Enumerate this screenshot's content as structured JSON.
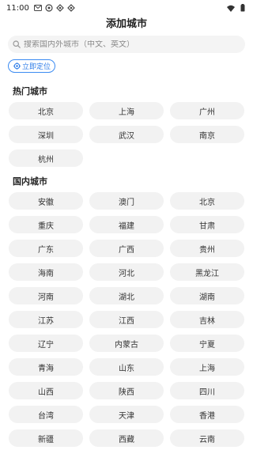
{
  "status_bar": {
    "time": "11:00",
    "left_icons": [
      "gmail-icon",
      "notification-icon",
      "app-icon",
      "app-icon"
    ],
    "right_icons": [
      "wifi-icon",
      "battery-icon"
    ]
  },
  "header": {
    "title": "添加城市"
  },
  "search": {
    "placeholder": "搜索国内外城市（中文、英文）"
  },
  "locate": {
    "label": "立即定位",
    "accent": "#2f7de8"
  },
  "hot_cities": {
    "title": "热门城市",
    "items": [
      "北京",
      "上海",
      "广州",
      "深圳",
      "武汉",
      "南京",
      "杭州"
    ]
  },
  "domestic_cities": {
    "title": "国内城市",
    "items": [
      "安徽",
      "澳门",
      "北京",
      "重庆",
      "福建",
      "甘肃",
      "广东",
      "广西",
      "贵州",
      "海南",
      "河北",
      "黑龙江",
      "河南",
      "湖北",
      "湖南",
      "江苏",
      "江西",
      "吉林",
      "辽宁",
      "内蒙古",
      "宁夏",
      "青海",
      "山东",
      "上海",
      "山西",
      "陕西",
      "四川",
      "台湾",
      "天津",
      "香港",
      "新疆",
      "西藏",
      "云南"
    ]
  }
}
